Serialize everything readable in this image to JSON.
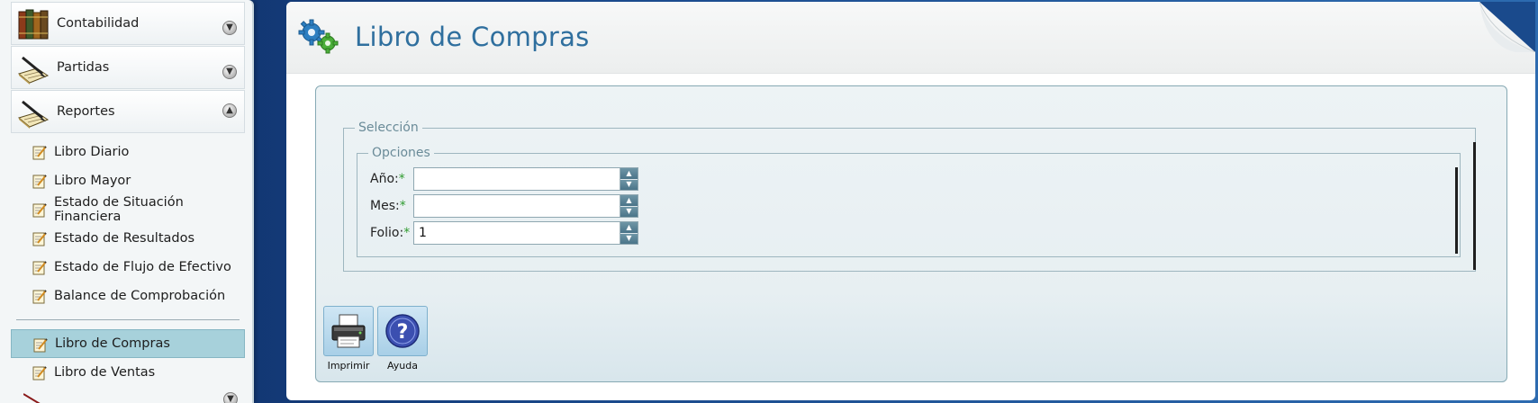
{
  "sidebar": {
    "sections": [
      {
        "label": "Contabilidad",
        "icon": "books-icon",
        "toggle": "expand"
      },
      {
        "label": "Partidas",
        "icon": "ledger-pen-icon",
        "toggle": "expand"
      },
      {
        "label": "Reportes",
        "icon": "ledger-pen-icon",
        "toggle": "collapse"
      }
    ],
    "report_items": [
      {
        "label": "Libro Diario"
      },
      {
        "label": "Libro Mayor"
      },
      {
        "label": "Estado de Situación Financiera"
      },
      {
        "label": "Estado de Resultados"
      },
      {
        "label": "Estado de Flujo de Efectivo"
      },
      {
        "label": "Balance de Comprobación"
      }
    ],
    "report_items_2": [
      {
        "label": "Libro de Compras",
        "active": true
      },
      {
        "label": "Libro de Ventas",
        "active": false
      }
    ]
  },
  "main": {
    "title": "Libro de Compras",
    "fieldset_outer_legend": "Selección",
    "fieldset_inner_legend": "Opciones",
    "fields": {
      "anio": {
        "label": "Año:",
        "required_mark": "*",
        "value": ""
      },
      "mes": {
        "label": "Mes:",
        "required_mark": "*",
        "value": ""
      },
      "folio": {
        "label": "Folio:",
        "required_mark": "*",
        "value": "1"
      }
    },
    "actions": {
      "print_label": "Imprimir",
      "help_label": "Ayuda"
    }
  },
  "colors": {
    "title": "#2f6f9e",
    "active_item": "#a7d1db",
    "required": "#2e9b2e",
    "background_blue": "#1a4a8c"
  }
}
